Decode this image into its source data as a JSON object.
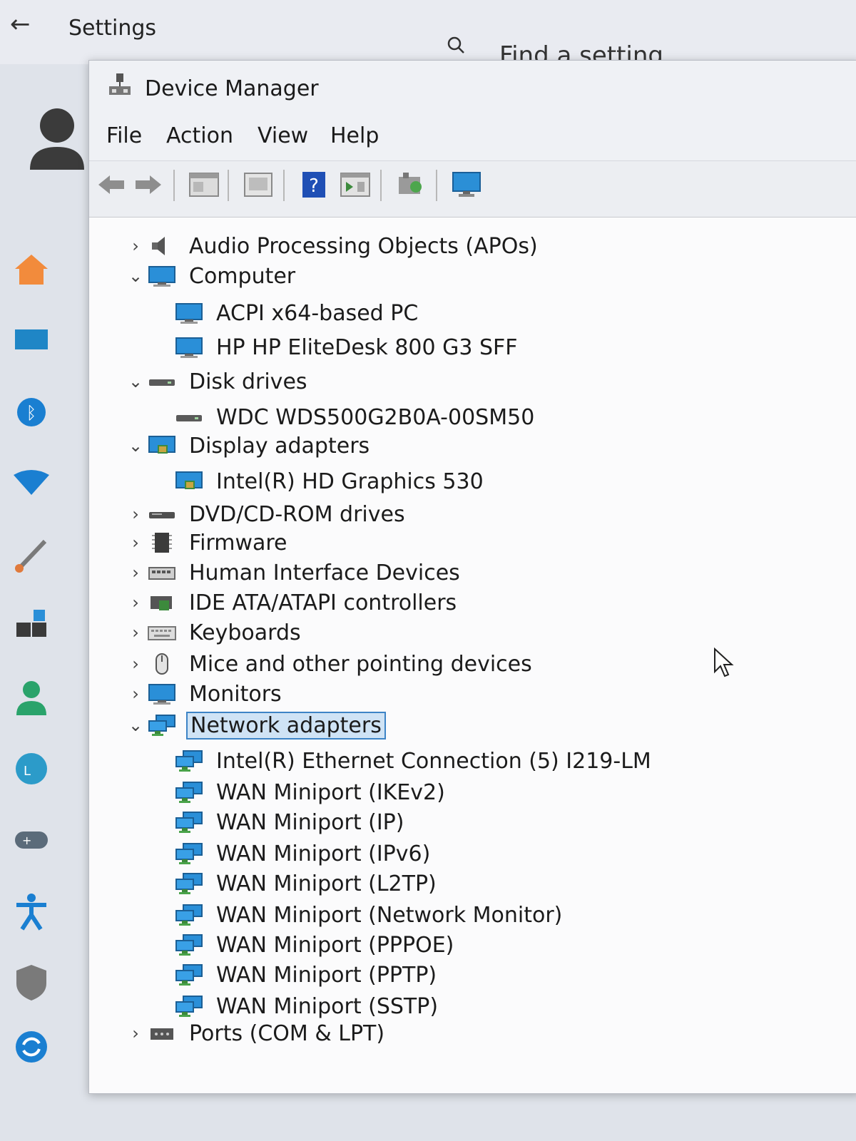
{
  "settings": {
    "title": "Settings",
    "search_placeholder": "Find a setting",
    "nav_icons": [
      "home-icon",
      "system-icon",
      "bluetooth-icon",
      "network-icon",
      "personalization-icon",
      "apps-icon",
      "accounts-icon",
      "time-language-icon",
      "gaming-icon",
      "accessibility-icon",
      "privacy-icon",
      "update-icon"
    ]
  },
  "device_manager": {
    "title": "Device Manager",
    "menu": [
      "File",
      "Action",
      "View",
      "Help"
    ],
    "toolbar": [
      "back",
      "forward",
      "properties",
      "update-driver",
      "help",
      "show-hidden",
      "scan-hardware",
      "display-monitor"
    ],
    "tree": [
      {
        "label": "Audio Processing Objects (APOs)",
        "level": 1,
        "expanded": false,
        "icon": "audio-icon"
      },
      {
        "label": "Computer",
        "level": 1,
        "expanded": true,
        "icon": "computer-icon"
      },
      {
        "label": "ACPI x64-based PC",
        "level": 2,
        "icon": "computer-icon"
      },
      {
        "label": "HP HP EliteDesk 800 G3 SFF",
        "level": 2,
        "icon": "computer-icon"
      },
      {
        "label": "Disk drives",
        "level": 1,
        "expanded": true,
        "icon": "disk-icon"
      },
      {
        "label": "WDC  WDS500G2B0A-00SM50",
        "level": 2,
        "icon": "disk-icon"
      },
      {
        "label": "Display adapters",
        "level": 1,
        "expanded": true,
        "icon": "display-adapter-icon"
      },
      {
        "label": "Intel(R) HD Graphics 530",
        "level": 2,
        "icon": "display-adapter-icon"
      },
      {
        "label": "DVD/CD-ROM drives",
        "level": 1,
        "expanded": false,
        "icon": "dvd-icon"
      },
      {
        "label": "Firmware",
        "level": 1,
        "expanded": false,
        "icon": "firmware-icon"
      },
      {
        "label": "Human Interface Devices",
        "level": 1,
        "expanded": false,
        "icon": "hid-icon"
      },
      {
        "label": "IDE ATA/ATAPI controllers",
        "level": 1,
        "expanded": false,
        "icon": "ide-icon"
      },
      {
        "label": "Keyboards",
        "level": 1,
        "expanded": false,
        "icon": "keyboard-icon"
      },
      {
        "label": "Mice and other pointing devices",
        "level": 1,
        "expanded": false,
        "icon": "mouse-icon"
      },
      {
        "label": "Monitors",
        "level": 1,
        "expanded": false,
        "icon": "monitor-icon"
      },
      {
        "label": "Network adapters",
        "level": 1,
        "expanded": true,
        "selected": true,
        "icon": "network-icon"
      },
      {
        "label": "Intel(R) Ethernet Connection (5) I219-LM",
        "level": 2,
        "icon": "network-icon"
      },
      {
        "label": "WAN Miniport (IKEv2)",
        "level": 2,
        "icon": "network-icon"
      },
      {
        "label": "WAN Miniport (IP)",
        "level": 2,
        "icon": "network-icon"
      },
      {
        "label": "WAN Miniport (IPv6)",
        "level": 2,
        "icon": "network-icon"
      },
      {
        "label": "WAN Miniport (L2TP)",
        "level": 2,
        "icon": "network-icon"
      },
      {
        "label": "WAN Miniport (Network Monitor)",
        "level": 2,
        "icon": "network-icon"
      },
      {
        "label": "WAN Miniport (PPPOE)",
        "level": 2,
        "icon": "network-icon"
      },
      {
        "label": "WAN Miniport (PPTP)",
        "level": 2,
        "icon": "network-icon"
      },
      {
        "label": "WAN Miniport (SSTP)",
        "level": 2,
        "icon": "network-icon"
      },
      {
        "label": "Ports (COM & LPT)",
        "level": 1,
        "expanded": false,
        "icon": "ports-icon"
      }
    ]
  }
}
